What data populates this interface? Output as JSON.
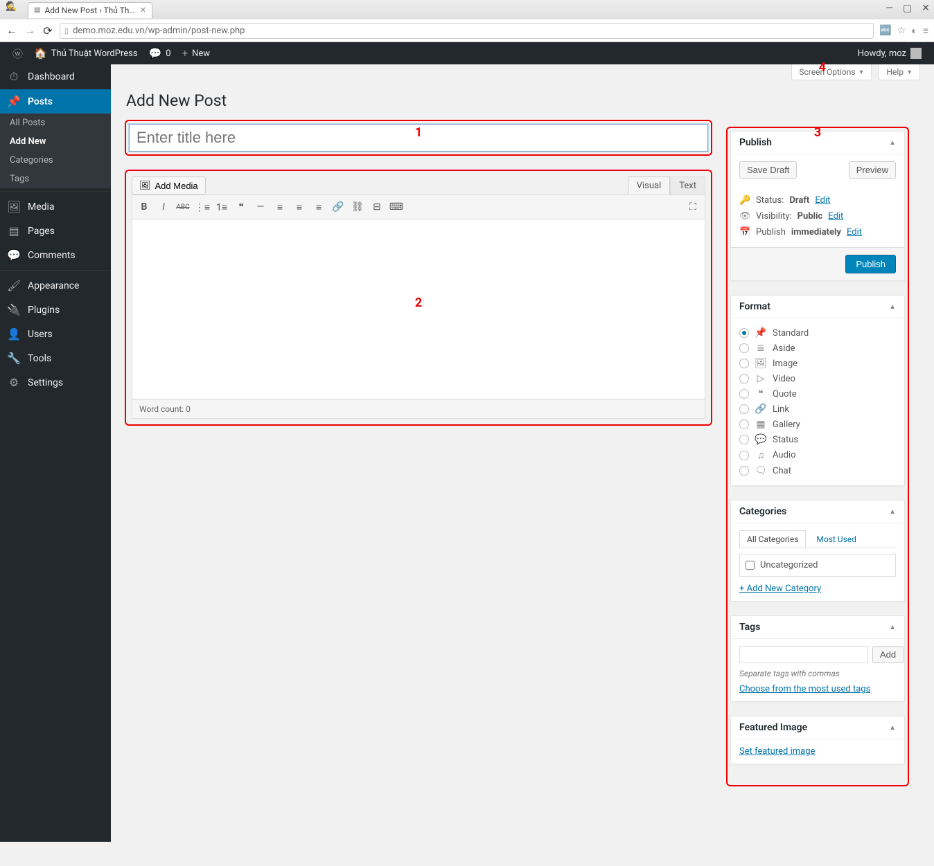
{
  "browser": {
    "tab_title": "Add New Post ‹ Thủ Thuậ…",
    "url": "demo.moz.edu.vn/wp-admin/post-new.php"
  },
  "adminbar": {
    "site_name": "Thủ Thuật WordPress",
    "comments_count": "0",
    "new_label": "New",
    "howdy": "Howdy, moz"
  },
  "menu": {
    "dashboard": "Dashboard",
    "posts": "Posts",
    "posts_sub": {
      "all": "All Posts",
      "add": "Add New",
      "cats": "Categories",
      "tags": "Tags"
    },
    "media": "Media",
    "pages": "Pages",
    "comments": "Comments",
    "appearance": "Appearance",
    "plugins": "Plugins",
    "users": "Users",
    "tools": "Tools",
    "settings": "Settings"
  },
  "screen_meta": {
    "screen_options": "Screen Options",
    "help": "Help"
  },
  "page": {
    "title": "Add New Post",
    "title_placeholder": "Enter title here"
  },
  "editor": {
    "add_media": "Add Media",
    "tab_visual": "Visual",
    "tab_text": "Text",
    "word_count": "Word count: 0"
  },
  "annotations": {
    "n1": "1",
    "n2": "2",
    "n3": "3",
    "n4": "4"
  },
  "publish": {
    "title": "Publish",
    "save_draft": "Save Draft",
    "preview": "Preview",
    "status_label": "Status:",
    "status_value": "Draft",
    "visibility_label": "Visibility:",
    "visibility_value": "Public",
    "schedule_label": "Publish",
    "schedule_value": "immediately",
    "edit": "Edit",
    "publish_btn": "Publish"
  },
  "format": {
    "title": "Format",
    "items": [
      {
        "label": "Standard",
        "icon": "📌",
        "checked": true
      },
      {
        "label": "Aside",
        "icon": "≣",
        "checked": false
      },
      {
        "label": "Image",
        "icon": "🖼",
        "checked": false
      },
      {
        "label": "Video",
        "icon": "▷",
        "checked": false
      },
      {
        "label": "Quote",
        "icon": "❝",
        "checked": false
      },
      {
        "label": "Link",
        "icon": "🔗",
        "checked": false
      },
      {
        "label": "Gallery",
        "icon": "▦",
        "checked": false
      },
      {
        "label": "Status",
        "icon": "💬",
        "checked": false
      },
      {
        "label": "Audio",
        "icon": "♫",
        "checked": false
      },
      {
        "label": "Chat",
        "icon": "🗨",
        "checked": false
      }
    ]
  },
  "categories": {
    "title": "Categories",
    "tab_all": "All Categories",
    "tab_most": "Most Used",
    "uncat": "Uncategorized",
    "add_new": "+ Add New Category"
  },
  "tags": {
    "title": "Tags",
    "add_btn": "Add",
    "hint": "Separate tags with commas",
    "choose": "Choose from the most used tags"
  },
  "featured": {
    "title": "Featured Image",
    "set": "Set featured image"
  }
}
